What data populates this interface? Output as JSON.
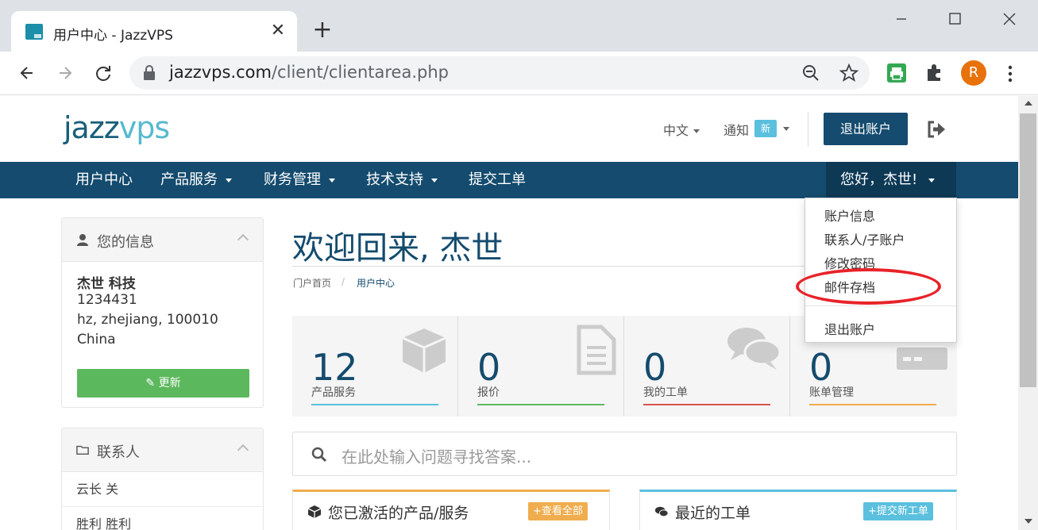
{
  "browser": {
    "tab_title": "用户中心 - JazzVPS",
    "tab_close": "✕",
    "new_tab": "+",
    "url_host": "jazzvps.com",
    "url_path": "/client/clientarea.php",
    "avatar_letter": "R"
  },
  "header": {
    "logo_a": "jazz",
    "logo_b": "vps",
    "language": "中文",
    "notifications": "通知",
    "notifications_badge": "新",
    "logout": "退出账户"
  },
  "nav": {
    "items": [
      {
        "label": "用户中心"
      },
      {
        "label": "产品服务"
      },
      {
        "label": "财务管理"
      },
      {
        "label": "技术支持"
      },
      {
        "label": "提交工单"
      }
    ],
    "user_greeting": "您好，杰世!"
  },
  "user_menu": {
    "items": [
      {
        "label": "账户信息"
      },
      {
        "label": "联系人/子账户"
      },
      {
        "label": "修改密码"
      },
      {
        "label": "邮件存档"
      },
      {
        "label": "退出账户"
      }
    ],
    "highlighted": "邮件存档",
    "highlight_color": "#e8232a"
  },
  "info_panel": {
    "title": "您的信息",
    "name": "杰世 科技",
    "id": "1234431",
    "address": "hz, zhejiang, 100010",
    "country": "China",
    "update_button": "更新"
  },
  "contacts_panel": {
    "title": "联系人",
    "items": [
      {
        "label": "云长 关"
      },
      {
        "label": "胜利 胜利"
      }
    ]
  },
  "main": {
    "welcome": "欢迎回来, 杰世",
    "breadcrumb": [
      "门户首页",
      "/",
      "用户中心"
    ],
    "stats": [
      {
        "value": "12",
        "label": "产品服务",
        "color": "#5bc0de"
      },
      {
        "value": "0",
        "label": "报价",
        "color": "#5cb85c"
      },
      {
        "value": "0",
        "label": "我的工单",
        "color": "#d9534f"
      },
      {
        "value": "0",
        "label": "账单管理",
        "color": "#f0ad4e"
      }
    ],
    "search_placeholder": "在此处输入问题寻找答案...",
    "boxes": [
      {
        "title": "您已激活的产品/服务",
        "button": "查看全部",
        "color": "#f0ad4e"
      },
      {
        "title": "最近的工单",
        "button": "提交新工单",
        "color": "#5bc0de"
      }
    ]
  },
  "colors": {
    "brand": "#144b6e",
    "brand_dark": "#0d3955",
    "accent": "#5bc0de"
  }
}
